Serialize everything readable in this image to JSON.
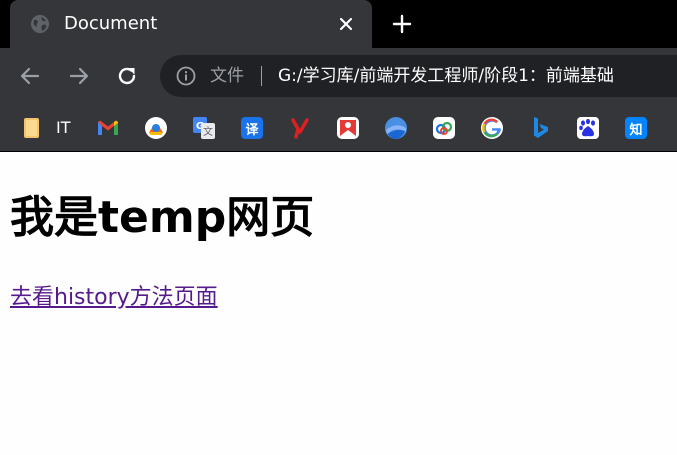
{
  "tab": {
    "title": "Document",
    "favicon": "globe-icon"
  },
  "toolbar": {
    "security_label": "文件",
    "url": "G:/学习库/前端开发工程师/阶段1：前端基础"
  },
  "bookmarks": {
    "folder_label": "IT",
    "items": [
      "gmail-icon",
      "bookmark-2-icon",
      "google-translate-icon",
      "translate-icon",
      "youdao-icon",
      "bookmark-6-icon",
      "google-earth-icon",
      "bookmark-8-icon",
      "google-icon",
      "bing-icon",
      "baidu-icon",
      "zhihu-icon"
    ]
  },
  "page": {
    "heading": "我是temp网页",
    "link": "去看history方法页面"
  },
  "colors": {
    "tabstrip": "#000000",
    "toolbar": "#35363a",
    "omnibox": "#202124",
    "link_visited": "#551a8b",
    "page_bg": "#fefefe"
  }
}
